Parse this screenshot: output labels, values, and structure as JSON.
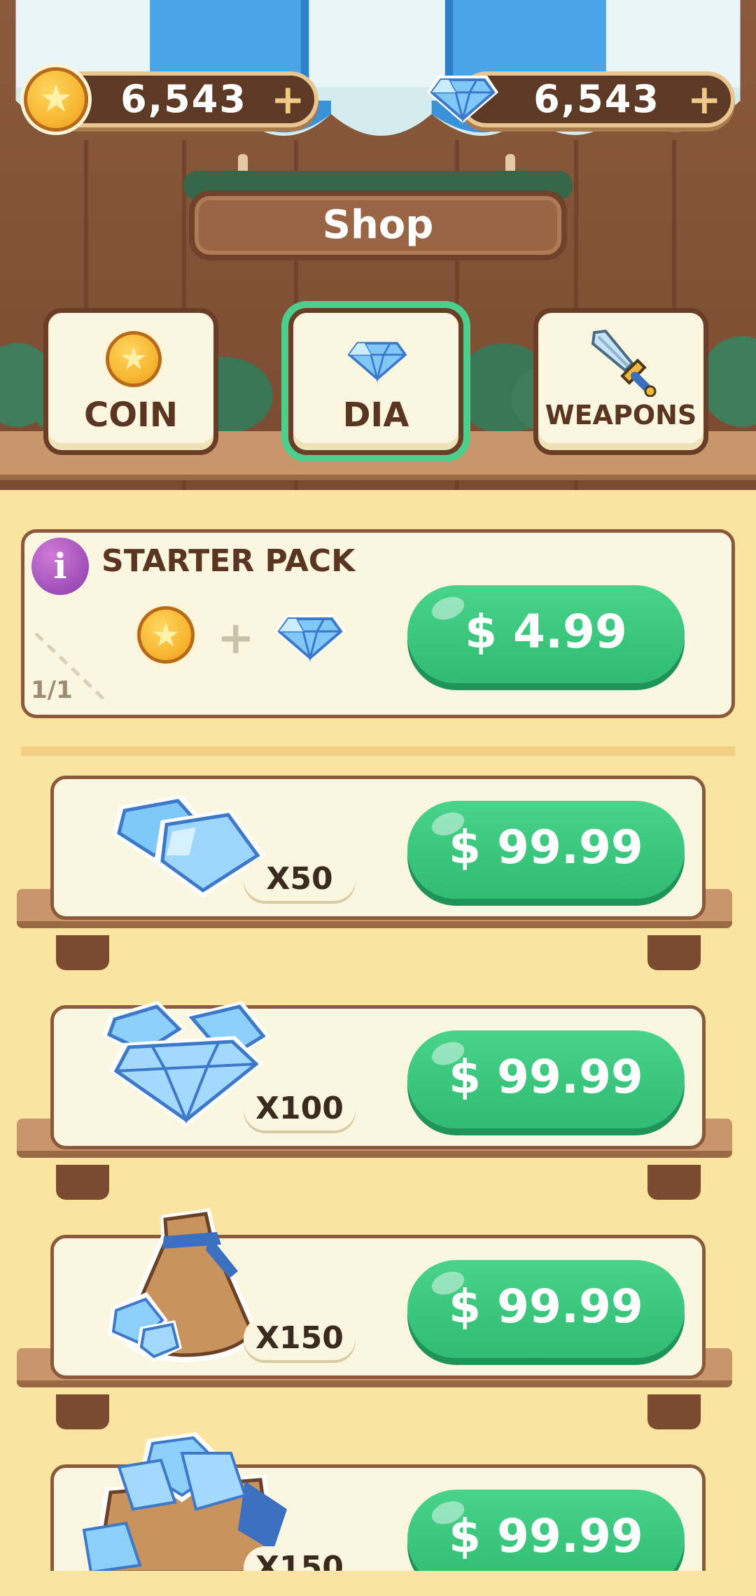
{
  "currency": {
    "coins": "6,543",
    "diamonds": "6,543",
    "plus_symbol": "+"
  },
  "header": {
    "title": "Shop"
  },
  "tabs": [
    {
      "label": "COIN",
      "icon": "coin-icon",
      "active": false
    },
    {
      "label": "DIA",
      "icon": "diamond-icon",
      "active": true
    },
    {
      "label": "WEAPONS",
      "icon": "sword-icon",
      "active": false
    }
  ],
  "starter_pack": {
    "title": "STARTER PACK",
    "info_symbol": "i",
    "plus_symbol": "+",
    "page": "1/1",
    "price": "$ 4.99"
  },
  "products": [
    {
      "quantity": "X50",
      "price": "$ 99.99",
      "icon": "diamond-pair-icon"
    },
    {
      "quantity": "X100",
      "price": "$ 99.99",
      "icon": "diamond-pile-icon"
    },
    {
      "quantity": "X150",
      "price": "$ 99.99",
      "icon": "diamond-sack-icon"
    },
    {
      "quantity": "X150",
      "price": "$ 99.99",
      "icon": "diamond-sack-open-icon"
    }
  ],
  "colors": {
    "accent_green": "#3cc77f",
    "wood_dark": "#6a3e26",
    "panel_cream": "#fbf6df",
    "background_yellow": "#fbe3a0",
    "active_tab_outline": "#4ccf8c"
  }
}
